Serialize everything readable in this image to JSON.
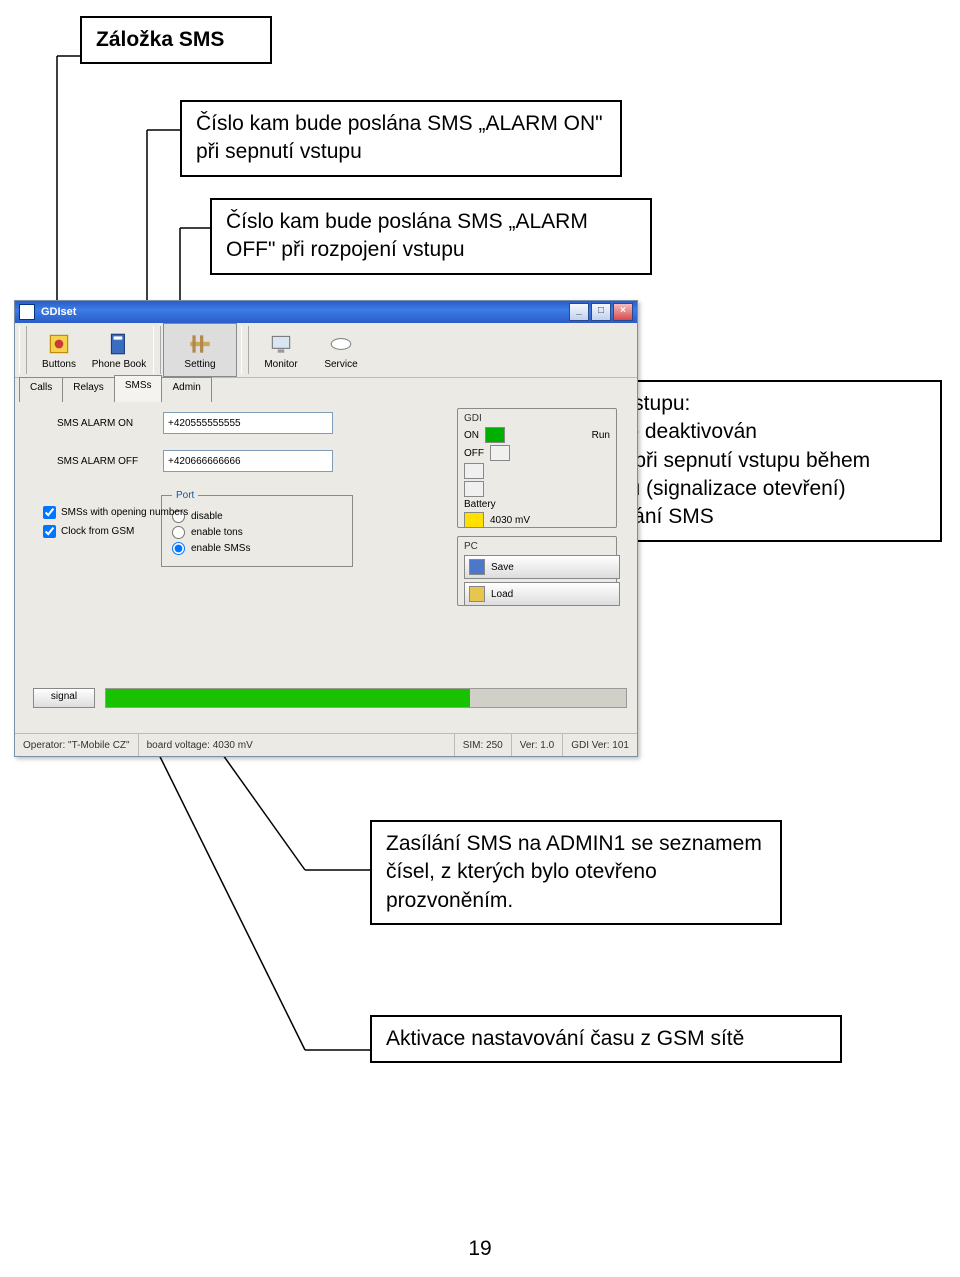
{
  "callouts": {
    "tab_sms": "Záložka SMS",
    "alarm_on": "Číslo kam bude poslána SMS „ALARM ON\" při sepnutí vstupu",
    "alarm_off": "Číslo kam bude poslána SMS „ALARM OFF\" při rozpojení vstupu",
    "mode_header": "Mód vstupu:",
    "mode_line1": "- vstup deaktivován",
    "mode_line2": "- tóny při sepnutí vstupu během hovoru (signalizace otevření)",
    "mode_line3": "- posílání SMS",
    "admin1": "Zasílání SMS na ADMIN1 se seznamem čísel, z kterých bylo otevřeno prozvoněním.",
    "gsm_time": "Aktivace nastavování času z GSM sítě"
  },
  "page_number": "19",
  "app": {
    "title": "GDIset",
    "win_min": "_",
    "win_max": "□",
    "win_close": "×",
    "toolbar": {
      "buttons": "Buttons",
      "phonebook": "Phone Book",
      "setting": "Setting",
      "monitor": "Monitor",
      "service": "Service"
    },
    "subtabs": {
      "calls": "Calls",
      "relays": "Relays",
      "smss": "SMSs",
      "admin": "Admin"
    },
    "form": {
      "sms_alarm_on_label": "SMS ALARM ON",
      "sms_alarm_on_value": "+420555555555",
      "sms_alarm_off_label": "SMS ALARM OFF",
      "sms_alarm_off_value": "+420666666666"
    },
    "port": {
      "legend": "Port",
      "disable": "disable",
      "enable_tons": "enable tons",
      "enable_smss": "enable SMSs"
    },
    "checks": {
      "sms_open_numbers": "SMSs with opening numbers",
      "clock_from_gsm": "Clock from GSM"
    },
    "gdi": {
      "header": "GDI",
      "on": "ON",
      "off": "OFF",
      "run": "Run",
      "battery": "Battery",
      "battery_val": "4030 mV"
    },
    "pc": {
      "header": "PC",
      "save": "Save",
      "load": "Load"
    },
    "signal": "signal",
    "status": {
      "operator": "Operator: \"T-Mobile CZ\"",
      "board_voltage": "board voltage: 4030 mV",
      "sim": "SIM: 250",
      "ver": "Ver: 1.0",
      "gdi_ver": "GDI Ver: 101"
    }
  }
}
